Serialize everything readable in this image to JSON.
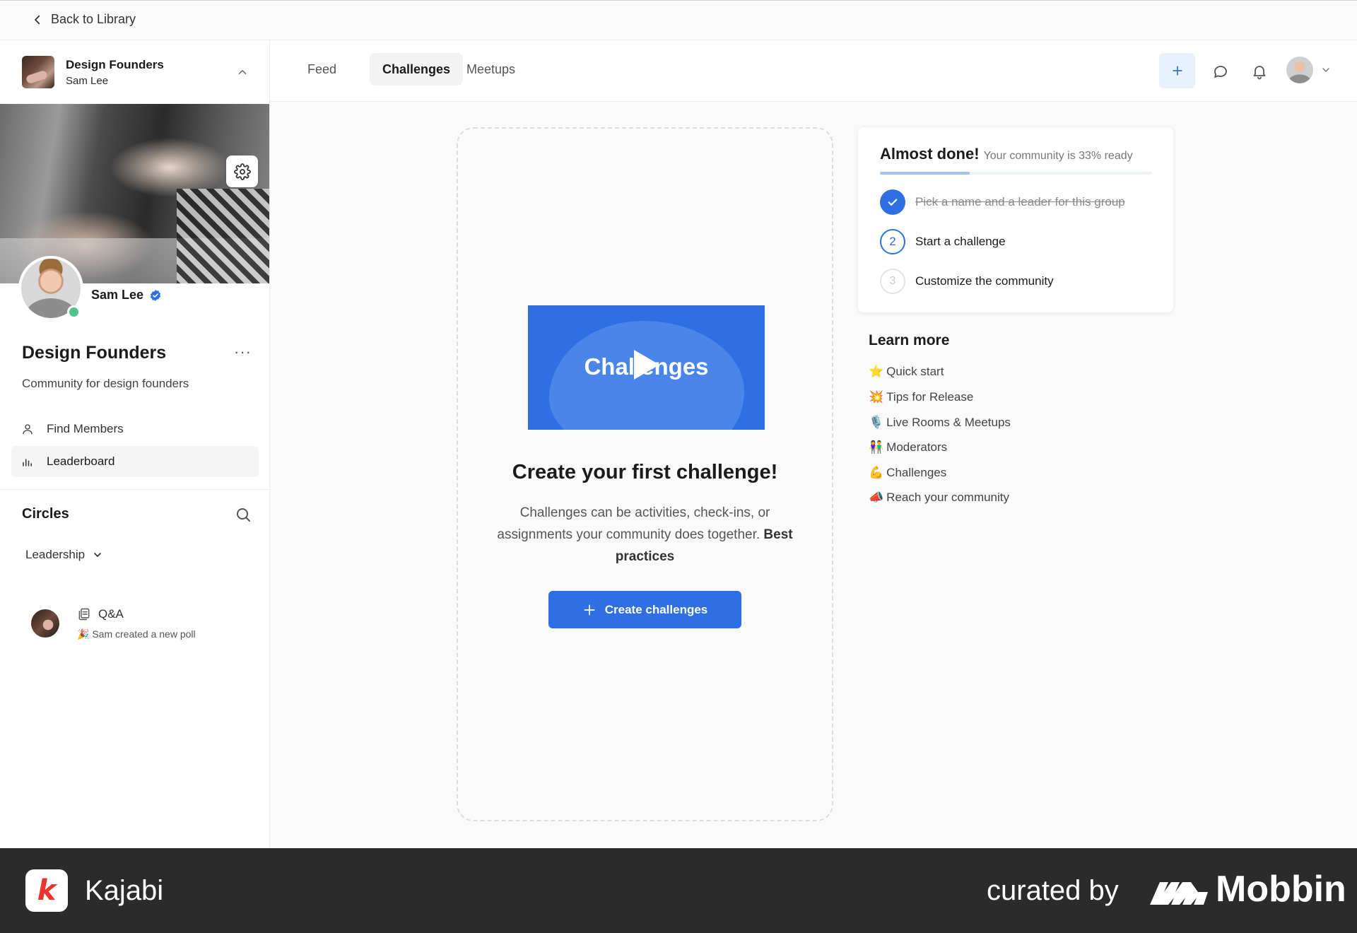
{
  "topbar": {
    "back_label": "Back to Library"
  },
  "sidebar": {
    "community_name": "Design Founders",
    "community_owner": "Sam Lee",
    "profile_name": "Sam Lee",
    "group_title": "Design Founders",
    "more_label": "···",
    "group_description": "Community for design founders",
    "nav": [
      {
        "label": "Find Members",
        "icon": "user-icon"
      },
      {
        "label": "Leaderboard",
        "icon": "bar-chart-icon"
      }
    ],
    "circles_title": "Circles",
    "circle_selected": "Leadership",
    "feed_item": {
      "title": "Q&A",
      "subtitle": "🎉 Sam created a new poll"
    }
  },
  "header": {
    "tabs": [
      {
        "label": "Feed"
      },
      {
        "label": "Challenges"
      },
      {
        "label": "Meetups"
      }
    ],
    "active_tab": "Challenges"
  },
  "empty_state": {
    "video_text": "Challenges",
    "title": "Create your first challenge!",
    "description": "Challenges can be activities, check-ins, or assignments your community does together.",
    "link_text": "Best practices",
    "button_label": "Create challenges"
  },
  "progress": {
    "title": "Almost done!",
    "subtitle": "Your community is 33% ready",
    "percent": 33,
    "steps": [
      {
        "number": "1",
        "label": "Pick a name and a leader for this group",
        "status": "done"
      },
      {
        "number": "2",
        "label": "Start a challenge",
        "status": "current"
      },
      {
        "number": "3",
        "label": "Customize the community",
        "status": "todo"
      }
    ]
  },
  "learn_more": {
    "title": "Learn more",
    "items": [
      {
        "emoji": "⭐",
        "label": "Quick start"
      },
      {
        "emoji": "💥",
        "label": "Tips for Release"
      },
      {
        "emoji": "🎙️",
        "label": "Live Rooms & Meetups"
      },
      {
        "emoji": "👫",
        "label": "Moderators"
      },
      {
        "emoji": "💪",
        "label": "Challenges"
      },
      {
        "emoji": "📣",
        "label": "Reach your community"
      }
    ]
  },
  "footer": {
    "brand": "Kajabi",
    "brand_letter": "k",
    "curated_label": "curated by",
    "curator": "Mobbin"
  },
  "colors": {
    "accent": "#2f6fe4",
    "online": "#4ec58a",
    "footer_bg": "#2b2b2b",
    "kajabi_red": "#e8352b"
  }
}
